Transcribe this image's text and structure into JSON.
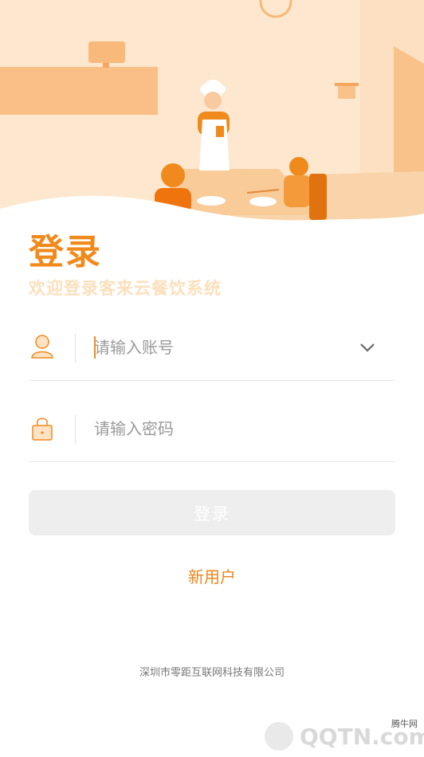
{
  "login": {
    "title": "登录",
    "subtitle": "欢迎登录客来云餐饮系统",
    "button_label": "登录",
    "new_user_label": "新用户"
  },
  "account": {
    "placeholder": "请输入账号",
    "value": "",
    "icon": "user-icon",
    "dropdown_icon": "chevron-down-icon"
  },
  "password": {
    "placeholder": "请输入密码",
    "value": "",
    "icon": "lock-icon"
  },
  "footer": {
    "company": "深圳市零距互联网科技有限公司"
  },
  "watermark": {
    "text": "腾牛网",
    "logo": "QQTN.com"
  },
  "colors": {
    "accent": "#f08a1c",
    "accent_light": "#fbe0bd",
    "hero_bg": "#fde7cf",
    "button_disabled": "#eeeeee"
  }
}
